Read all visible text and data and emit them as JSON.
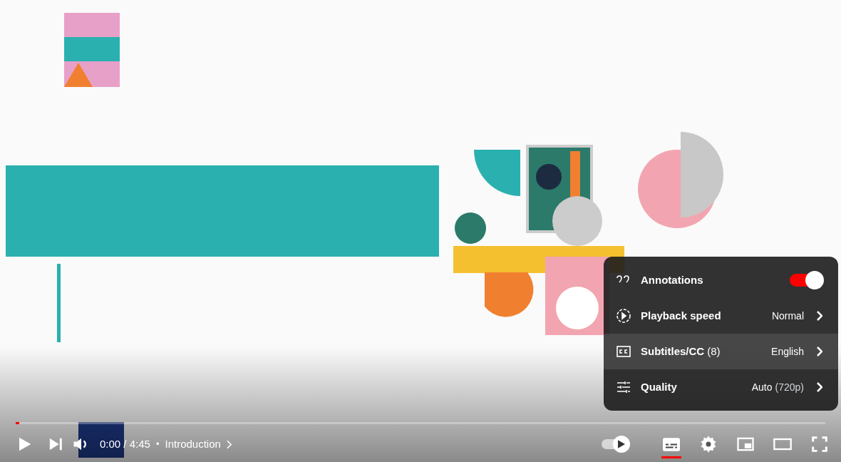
{
  "player": {
    "settings_menu": [
      {
        "kind": "toggle",
        "label": "Annotations",
        "on": true,
        "selected": false
      },
      {
        "kind": "submenu",
        "label": "Playback speed",
        "value": "Normal",
        "selected": false
      },
      {
        "kind": "submenu",
        "label": "Subtitles/CC",
        "count": "(8)",
        "value": "English",
        "selected": true
      },
      {
        "kind": "submenu",
        "label": "Quality",
        "value": "Auto",
        "value_note": "(720p)",
        "selected": false
      }
    ],
    "progress": {
      "level": 0.004
    },
    "time": "0:00 / 4:45",
    "separator": "•",
    "chapter": "Introduction",
    "autoplay": {
      "on": true
    },
    "subtitles_button": {
      "active": true
    }
  }
}
